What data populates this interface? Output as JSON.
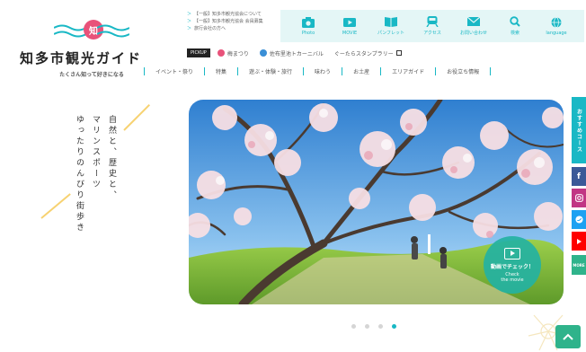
{
  "logo": {
    "title": "知多市観光ガイド",
    "tagline": "たくさん知って好きになる",
    "mark_text": "知"
  },
  "news": [
    "【一般】知多市観光協会について",
    "【一般】知多市観光協会 会員募集",
    "旅行会社の方へ"
  ],
  "iconbar": [
    {
      "label": "Photo",
      "icon": "camera-icon"
    },
    {
      "label": "MOVIE",
      "icon": "video-icon"
    },
    {
      "label": "パンフレット",
      "icon": "book-icon"
    },
    {
      "label": "アクセス",
      "icon": "train-icon"
    },
    {
      "label": "お問い合わせ",
      "icon": "mail-icon"
    },
    {
      "label": "検索",
      "icon": "search-icon"
    },
    {
      "label": "language",
      "icon": "globe-icon"
    }
  ],
  "pickup": {
    "badge": "PICKUP",
    "items": [
      "梅まつり",
      "佐布里池トカーニバル",
      "ぐーたらスタンプラリー"
    ]
  },
  "nav": [
    "イベント・祭り",
    "特集",
    "遊ぶ・体験・旅行",
    "味わう",
    "お土産",
    "エリアガイド",
    "お役立ち情報"
  ],
  "copy": [
    "自然と、歴史と、",
    "マリンスポーツ",
    "ゆったりのんびり街歩き"
  ],
  "hero": {
    "movie_label": "動画でチェック！",
    "movie_sub": "Check\nthe movie"
  },
  "slider": {
    "count": 4,
    "active": 4
  },
  "side": {
    "course": "おすすめコース",
    "more": "MORE"
  },
  "colors": {
    "accent": "#19b8c5",
    "pink": "#e8527a",
    "green": "#2fb38b"
  }
}
